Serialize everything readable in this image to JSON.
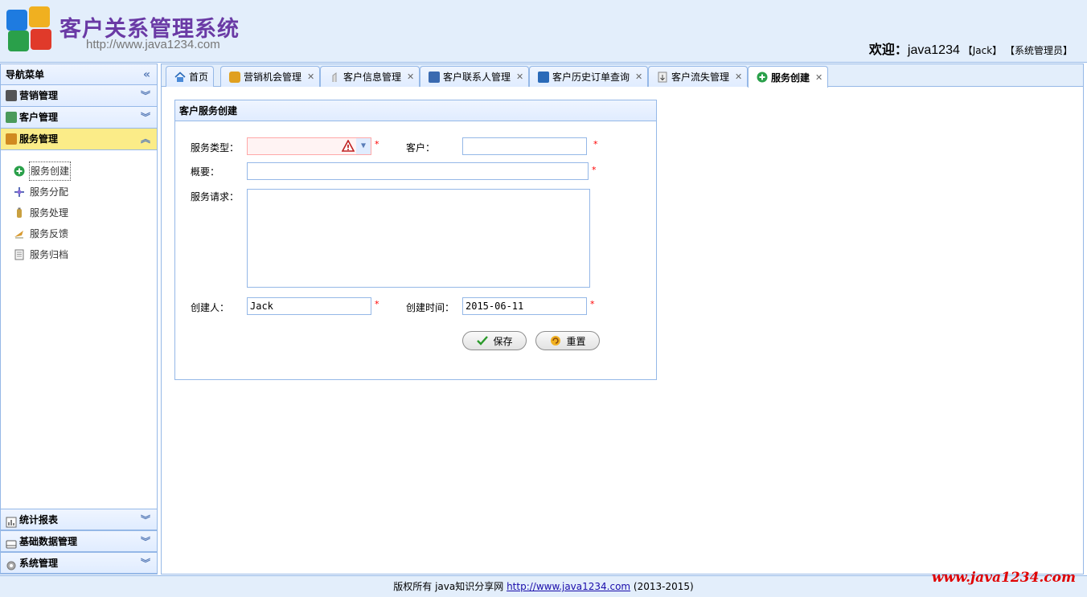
{
  "header": {
    "title": "客户关系管理系统",
    "url": "http://www.java1234.com",
    "welcome_label": "欢迎：",
    "username": "java1234",
    "user_name_tag": "【Jack】",
    "role_tag": "【系统管理员】"
  },
  "sidebar": {
    "nav_title": "导航菜单",
    "sections_top": [
      {
        "label": "营销管理",
        "icon": "marketing-icon"
      },
      {
        "label": "客户管理",
        "icon": "customers-icon"
      },
      {
        "label": "服务管理",
        "icon": "service-icon"
      }
    ],
    "service_items": [
      {
        "label": "服务创建",
        "icon": "add-circle-icon"
      },
      {
        "label": "服务分配",
        "icon": "assign-icon"
      },
      {
        "label": "服务处理",
        "icon": "process-icon"
      },
      {
        "label": "服务反馈",
        "icon": "feedback-icon"
      },
      {
        "label": "服务归档",
        "icon": "archive-icon"
      }
    ],
    "sections_bottom": [
      {
        "label": "统计报表",
        "icon": "chart-icon"
      },
      {
        "label": "基础数据管理",
        "icon": "database-icon"
      },
      {
        "label": "系统管理",
        "icon": "gear-icon"
      }
    ]
  },
  "tabs": [
    {
      "label": "首页",
      "icon": "home-icon"
    },
    {
      "label": "营销机会管理",
      "icon": "coin-icon"
    },
    {
      "label": "客户信息管理",
      "icon": "user-info-icon"
    },
    {
      "label": "客户联系人管理",
      "icon": "contacts-icon"
    },
    {
      "label": "客户历史订单查询",
      "icon": "order-history-icon"
    },
    {
      "label": "客户流失管理",
      "icon": "customer-loss-icon"
    },
    {
      "label": "服务创建",
      "icon": "add-circle-icon"
    }
  ],
  "form": {
    "panel_title": "客户服务创建",
    "service_type_label": "服务类型：",
    "service_type_value": "",
    "customer_label": "客户：",
    "customer_value": "",
    "summary_label": "概要：",
    "summary_value": "",
    "request_label": "服务请求：",
    "request_value": "",
    "creator_label": "创建人：",
    "creator_value": "Jack",
    "create_time_label": "创建时间：",
    "create_time_value": "2015-06-11",
    "required_mark": "*",
    "save_label": "保存",
    "reset_label": "重置"
  },
  "footer": {
    "prefix": "版权所有 java知识分享网 ",
    "link": "http://www.java1234.com",
    "suffix": " (2013-2015)",
    "watermark": "www.java1234.com"
  },
  "colors": {
    "border": "#95b8e7",
    "header_bg": "#e3eefb",
    "active_section": "#fbec88",
    "title_purple": "#6a3aa5",
    "required": "#ff0000"
  }
}
